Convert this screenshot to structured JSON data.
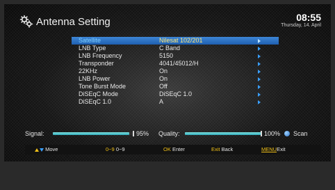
{
  "header": {
    "title": "Antenna Setting",
    "time": "08:55",
    "date": "Thursday, 14. April"
  },
  "settings": [
    {
      "label": "Satellite",
      "value": "Nilesat 102/201",
      "selected": true
    },
    {
      "label": "LNB Type",
      "value": "C Band",
      "selected": false
    },
    {
      "label": "LNB Frequency",
      "value": "5150",
      "selected": false
    },
    {
      "label": "Transponder",
      "value": "4041/45012/H",
      "selected": false
    },
    {
      "label": "22KHz",
      "value": "On",
      "selected": false
    },
    {
      "label": "LNB Power",
      "value": "On",
      "selected": false
    },
    {
      "label": "Tone Burst Mode",
      "value": "Off",
      "selected": false
    },
    {
      "label": "DiSEqC Mode",
      "value": "DiSEqC 1.0",
      "selected": false
    },
    {
      "label": "DiSEqC 1.0",
      "value": "A",
      "selected": false
    }
  ],
  "status": {
    "signal_label": "Signal:",
    "signal_value": "95%",
    "signal_level": 0.95,
    "quality_label": "Quality:",
    "quality_value": "100%",
    "quality_level": 1.0,
    "scan_label": "Scan"
  },
  "help": {
    "move_label": "Move",
    "digits_key": "0~9",
    "digits_label": "0~9",
    "ok_key": "OK",
    "ok_label": "Enter",
    "exit_key": "Exit",
    "exit_label": "Back",
    "menu_key": "MENU",
    "menu_label": "Exit"
  },
  "colors": {
    "selection": "#2f74c6",
    "selected_value": "#ffe87a",
    "key_yellow": "#f0c018",
    "arrow_blue": "#3aa0ff",
    "bar_cyan": "#5fcfd6"
  },
  "icons": {
    "title_icon": "antenna-settings-gears-icon",
    "row_arrow": "right-arrow-icon",
    "scan": "scan-dot-icon"
  }
}
